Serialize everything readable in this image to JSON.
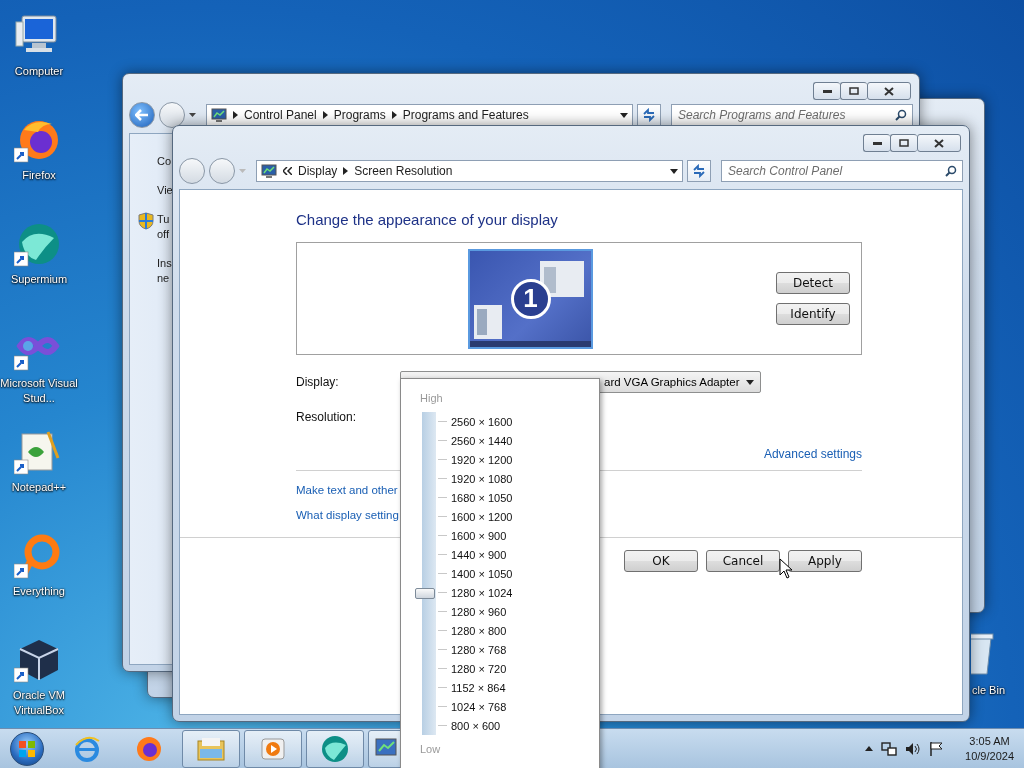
{
  "desktop_icons": [
    {
      "label": "Computer",
      "kind": "computer",
      "shortcut": false
    },
    {
      "label": "Firefox",
      "kind": "firefox",
      "shortcut": true
    },
    {
      "label": "Supermium",
      "kind": "supermium",
      "shortcut": true
    },
    {
      "label": "Microsoft Visual Stud...",
      "kind": "visual-studio",
      "shortcut": true
    },
    {
      "label": "Notepad++",
      "kind": "notepad",
      "shortcut": true
    },
    {
      "label": "Everything",
      "kind": "everything",
      "shortcut": true
    },
    {
      "label": "Oracle VM VirtualBox",
      "kind": "virtualbox",
      "shortcut": true
    }
  ],
  "recycle_bin": {
    "label": "cle Bin"
  },
  "back_window": {
    "breadcrumb": [
      "Control Panel",
      "Programs",
      "Programs and Features"
    ],
    "search": {
      "placeholder": "Search Programs and Features"
    },
    "sidebar": [
      {
        "lines": [
          "Co"
        ],
        "kind": "text"
      },
      {
        "lines": [
          "Vie"
        ],
        "kind": "text"
      },
      {
        "lines": [
          "Tu",
          "off"
        ],
        "kind": "shield"
      },
      {
        "lines": [
          "Ins",
          "ne"
        ],
        "kind": "text"
      }
    ]
  },
  "window": {
    "breadcrumb": [
      "Display",
      "Screen Resolution"
    ],
    "search": {
      "placeholder": "Search Control Panel"
    },
    "heading": "Change the appearance of your display",
    "monitor_number": "1",
    "side_buttons": [
      "Detect",
      "Identify"
    ],
    "display": {
      "label": "Display:",
      "value": "ard VGA Graphics Adapter"
    },
    "resolution": {
      "label": "Resolution:"
    },
    "advanced_link": "Advanced settings",
    "links": [
      "Make text and other",
      "What display setting"
    ],
    "buttons": [
      "OK",
      "Cancel",
      "Apply"
    ]
  },
  "resolution_menu": {
    "high": "High",
    "low": "Low",
    "level": 0.4375,
    "options": [
      "2560 × 1600",
      "2560 × 1440",
      "1920 × 1200",
      "1920 × 1080",
      "1680 × 1050",
      "1600 × 1200",
      "1600 × 900",
      "1440 × 900",
      "1400 × 1050",
      "1280 × 1024",
      "1280 × 960",
      "1280 × 800",
      "1280 × 768",
      "1280 × 720",
      "1152 × 864",
      "1024 × 768",
      "800 × 600"
    ]
  },
  "taskbar": {
    "items": [
      {
        "kind": "ie",
        "running": false
      },
      {
        "kind": "firefox",
        "running": false
      },
      {
        "kind": "explorer",
        "running": true
      },
      {
        "kind": "media",
        "running": true
      },
      {
        "kind": "supermium",
        "running": true
      },
      {
        "kind": "control-panel",
        "running": true
      }
    ],
    "clock": {
      "time": "3:05 AM",
      "date": "10/9/2024"
    }
  }
}
